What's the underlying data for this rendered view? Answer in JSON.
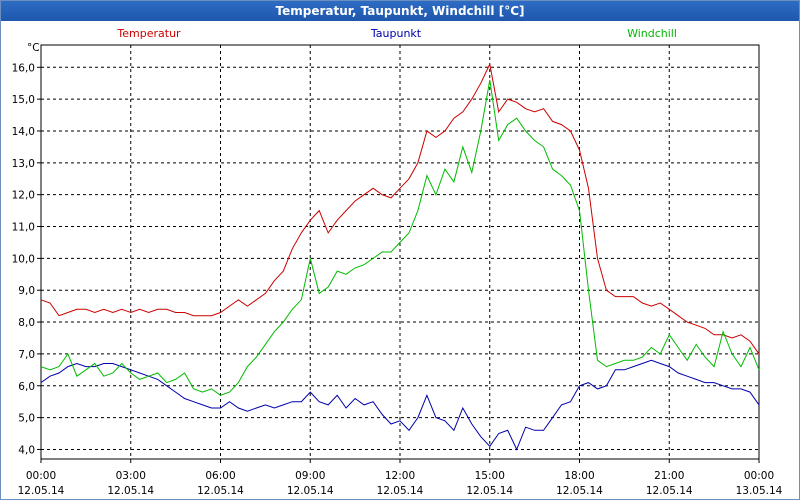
{
  "window": {
    "title": "Temperatur, Taupunkt, Windchill [°C]"
  },
  "colors": {
    "temperatur": "#cc0000",
    "taupunkt": "#0000aa",
    "windchill": "#00bb00",
    "grid": "#000000"
  },
  "chart_data": {
    "type": "line",
    "title": "Temperatur, Taupunkt, Windchill [°C]",
    "ylabel": "°C",
    "xlabel": "",
    "ylim": [
      3.7,
      16.7
    ],
    "xlim": [
      0,
      24
    ],
    "grid": true,
    "legend_placement": "top",
    "y_ticks": [
      "16,0",
      "15,0",
      "14,0",
      "13,0",
      "12,0",
      "11,0",
      "10,0",
      "9,0",
      "8,0",
      "7,0",
      "6,0",
      "5,0",
      "4,0"
    ],
    "y_tick_values": [
      16,
      15,
      14,
      13,
      12,
      11,
      10,
      9,
      8,
      7,
      6,
      5,
      4
    ],
    "x_ticks": [
      {
        "hour": 0,
        "time": "00:00",
        "date": "12.05.14"
      },
      {
        "hour": 3,
        "time": "03:00",
        "date": "12.05.14"
      },
      {
        "hour": 6,
        "time": "06:00",
        "date": "12.05.14"
      },
      {
        "hour": 9,
        "time": "09:00",
        "date": "12.05.14"
      },
      {
        "hour": 12,
        "time": "12:00",
        "date": "12.05.14"
      },
      {
        "hour": 15,
        "time": "15:00",
        "date": "12.05.14"
      },
      {
        "hour": 18,
        "time": "18:00",
        "date": "12.05.14"
      },
      {
        "hour": 21,
        "time": "21:00",
        "date": "12.05.14"
      },
      {
        "hour": 24,
        "time": "00:00",
        "date": "13.05.14"
      }
    ],
    "series": [
      {
        "name": "Temperatur",
        "color": "#cc0000",
        "x": [
          0,
          0.3,
          0.6,
          0.9,
          1.2,
          1.5,
          1.8,
          2.1,
          2.4,
          2.7,
          3.0,
          3.3,
          3.6,
          3.9,
          4.2,
          4.5,
          4.8,
          5.1,
          5.4,
          5.7,
          6.0,
          6.3,
          6.6,
          6.9,
          7.2,
          7.5,
          7.8,
          8.1,
          8.4,
          8.7,
          9.0,
          9.3,
          9.6,
          9.9,
          10.2,
          10.5,
          10.8,
          11.1,
          11.4,
          11.7,
          12.0,
          12.3,
          12.6,
          12.9,
          13.2,
          13.5,
          13.8,
          14.1,
          14.4,
          14.7,
          15.0,
          15.3,
          15.6,
          15.9,
          16.2,
          16.5,
          16.8,
          17.1,
          17.4,
          17.7,
          18.0,
          18.3,
          18.6,
          18.9,
          19.2,
          19.5,
          19.8,
          20.1,
          20.4,
          20.7,
          21.0,
          21.3,
          21.6,
          21.9,
          22.2,
          22.5,
          22.8,
          23.1,
          23.4,
          23.7,
          24.0
        ],
        "values": [
          8.7,
          8.6,
          8.2,
          8.3,
          8.4,
          8.4,
          8.3,
          8.4,
          8.3,
          8.4,
          8.3,
          8.4,
          8.3,
          8.4,
          8.4,
          8.3,
          8.3,
          8.2,
          8.2,
          8.2,
          8.3,
          8.5,
          8.7,
          8.5,
          8.7,
          8.9,
          9.3,
          9.6,
          10.3,
          10.8,
          11.2,
          11.5,
          10.8,
          11.2,
          11.5,
          11.8,
          12.0,
          12.2,
          12.0,
          11.9,
          12.2,
          12.5,
          13.0,
          14.0,
          13.8,
          14.0,
          14.4,
          14.6,
          15.0,
          15.5,
          16.1,
          14.6,
          15.0,
          14.9,
          14.7,
          14.6,
          14.7,
          14.3,
          14.2,
          14.0,
          13.4,
          12.2,
          10.0,
          9.0,
          8.8,
          8.8,
          8.8,
          8.6,
          8.5,
          8.6,
          8.4,
          8.2,
          8.0,
          7.9,
          7.8,
          7.6,
          7.6,
          7.5,
          7.6,
          7.4,
          7.0
        ]
      },
      {
        "name": "Taupunkt",
        "color": "#0000aa",
        "x": [
          0,
          0.3,
          0.6,
          0.9,
          1.2,
          1.5,
          1.8,
          2.1,
          2.4,
          2.7,
          3.0,
          3.3,
          3.6,
          3.9,
          4.2,
          4.5,
          4.8,
          5.1,
          5.4,
          5.7,
          6.0,
          6.3,
          6.6,
          6.9,
          7.2,
          7.5,
          7.8,
          8.1,
          8.4,
          8.7,
          9.0,
          9.3,
          9.6,
          9.9,
          10.2,
          10.5,
          10.8,
          11.1,
          11.4,
          11.7,
          12.0,
          12.3,
          12.6,
          12.9,
          13.2,
          13.5,
          13.8,
          14.1,
          14.4,
          14.7,
          15.0,
          15.3,
          15.6,
          15.9,
          16.2,
          16.5,
          16.8,
          17.1,
          17.4,
          17.7,
          18.0,
          18.3,
          18.6,
          18.9,
          19.2,
          19.5,
          19.8,
          20.1,
          20.4,
          20.7,
          21.0,
          21.3,
          21.6,
          21.9,
          22.2,
          22.5,
          22.8,
          23.1,
          23.4,
          23.7,
          24.0
        ],
        "values": [
          6.1,
          6.3,
          6.4,
          6.6,
          6.7,
          6.6,
          6.6,
          6.7,
          6.7,
          6.6,
          6.5,
          6.4,
          6.3,
          6.2,
          6.0,
          5.8,
          5.6,
          5.5,
          5.4,
          5.3,
          5.3,
          5.5,
          5.3,
          5.2,
          5.3,
          5.4,
          5.3,
          5.4,
          5.5,
          5.5,
          5.8,
          5.5,
          5.4,
          5.7,
          5.3,
          5.6,
          5.4,
          5.5,
          5.1,
          4.8,
          4.9,
          4.6,
          5.0,
          5.7,
          5.0,
          4.9,
          4.6,
          5.3,
          4.8,
          4.4,
          4.1,
          4.5,
          4.6,
          4.0,
          4.7,
          4.6,
          4.6,
          5.0,
          5.4,
          5.5,
          6.0,
          6.1,
          5.9,
          6.0,
          6.5,
          6.5,
          6.6,
          6.7,
          6.8,
          6.7,
          6.6,
          6.4,
          6.3,
          6.2,
          6.1,
          6.1,
          6.0,
          5.9,
          5.9,
          5.8,
          5.4
        ]
      },
      {
        "name": "Windchill",
        "color": "#00bb00",
        "x": [
          0,
          0.3,
          0.6,
          0.9,
          1.2,
          1.5,
          1.8,
          2.1,
          2.4,
          2.7,
          3.0,
          3.3,
          3.6,
          3.9,
          4.2,
          4.5,
          4.8,
          5.1,
          5.4,
          5.7,
          6.0,
          6.3,
          6.6,
          6.9,
          7.2,
          7.5,
          7.8,
          8.1,
          8.4,
          8.7,
          9.0,
          9.3,
          9.6,
          9.9,
          10.2,
          10.5,
          10.8,
          11.1,
          11.4,
          11.7,
          12.0,
          12.3,
          12.6,
          12.9,
          13.2,
          13.5,
          13.8,
          14.1,
          14.4,
          14.7,
          15.0,
          15.3,
          15.6,
          15.9,
          16.2,
          16.5,
          16.8,
          17.1,
          17.4,
          17.7,
          18.0,
          18.3,
          18.6,
          18.9,
          19.2,
          19.5,
          19.8,
          20.1,
          20.4,
          20.7,
          21.0,
          21.3,
          21.6,
          21.9,
          22.2,
          22.5,
          22.8,
          23.1,
          23.4,
          23.7,
          24.0
        ],
        "values": [
          6.6,
          6.5,
          6.6,
          7.0,
          6.3,
          6.5,
          6.7,
          6.3,
          6.4,
          6.7,
          6.4,
          6.2,
          6.3,
          6.4,
          6.1,
          6.2,
          6.4,
          5.9,
          5.8,
          5.9,
          5.7,
          5.8,
          6.1,
          6.6,
          6.9,
          7.3,
          7.7,
          8.0,
          8.4,
          8.7,
          10.0,
          8.9,
          9.1,
          9.6,
          9.5,
          9.7,
          9.8,
          10.0,
          10.2,
          10.2,
          10.5,
          10.8,
          11.5,
          12.6,
          12.0,
          12.8,
          12.4,
          13.5,
          12.7,
          14.0,
          15.6,
          13.7,
          14.2,
          14.4,
          14.0,
          13.7,
          13.5,
          12.8,
          12.6,
          12.3,
          11.5,
          9.0,
          6.8,
          6.6,
          6.7,
          6.8,
          6.8,
          6.9,
          7.2,
          7.0,
          7.6,
          7.2,
          6.8,
          7.3,
          6.9,
          6.6,
          7.7,
          7.0,
          6.6,
          7.2,
          6.5
        ]
      }
    ]
  }
}
